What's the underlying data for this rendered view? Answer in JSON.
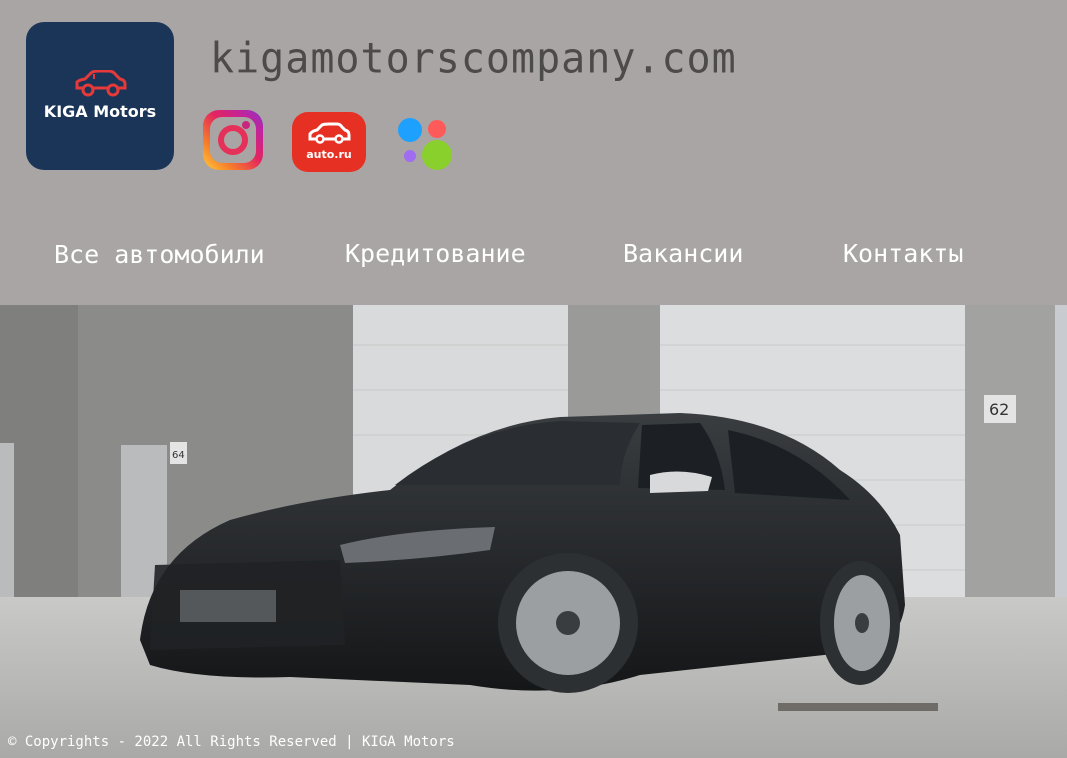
{
  "brand": {
    "logo_text": "KIGA Motors",
    "domain": "kigamotorscompany.com",
    "color": "#1a3557"
  },
  "social": [
    {
      "icon": "instagram-icon"
    },
    {
      "icon": "autoru-icon",
      "label": "auto.ru"
    },
    {
      "icon": "dots-icon"
    }
  ],
  "nav": {
    "all_cars": "Все автомобили",
    "credit": "Кредитование",
    "vacancies": "Вакансии",
    "contacts": "Контакты"
  },
  "hero": {
    "building_number_left": "64",
    "building_number_right": "62"
  },
  "footer": {
    "text": "© Copyrights - 2022 All Rights Reserved | KIGA Motors"
  }
}
